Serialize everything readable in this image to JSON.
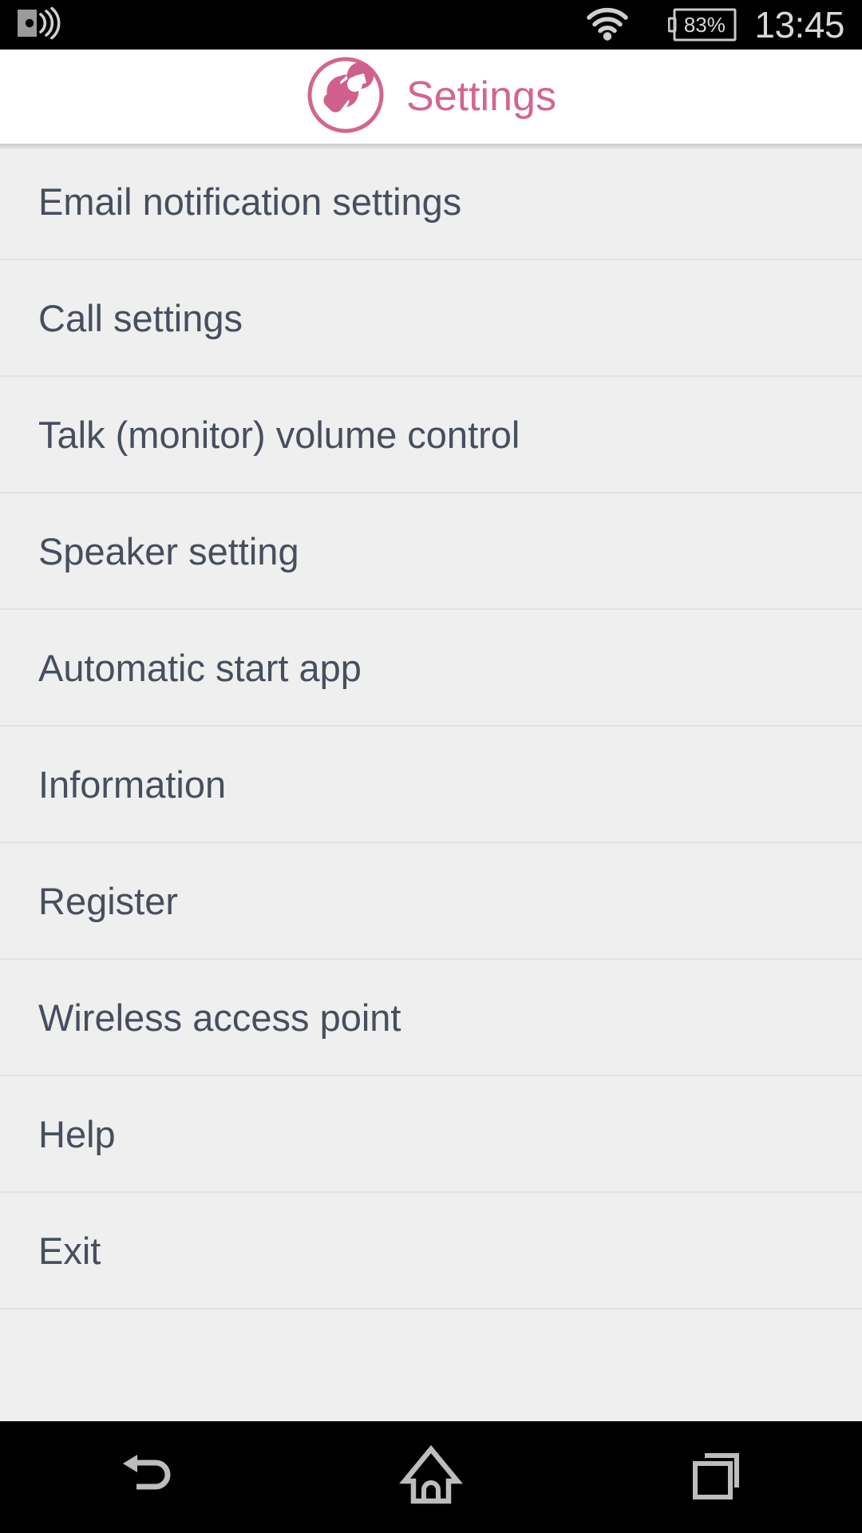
{
  "status_bar": {
    "sound_icon": "vibrate-sound-icon",
    "wifi_icon": "wifi-icon",
    "battery_icon": "battery-icon",
    "battery_level": "83%",
    "clock": "13:45"
  },
  "header": {
    "icon": "wrench-circle-icon",
    "title": "Settings",
    "accent_color": "#d4658f"
  },
  "list": {
    "items": [
      {
        "label": "Email notification settings"
      },
      {
        "label": "Call settings"
      },
      {
        "label": "Talk (monitor) volume control"
      },
      {
        "label": "Speaker setting"
      },
      {
        "label": "Automatic start app"
      },
      {
        "label": "Information"
      },
      {
        "label": "Register"
      },
      {
        "label": "Wireless access point"
      },
      {
        "label": "Help"
      },
      {
        "label": "Exit"
      }
    ]
  },
  "nav_bar": {
    "back": "back-icon",
    "home": "home-icon",
    "recents": "recents-icon"
  },
  "colors": {
    "accent": "#d4658f",
    "list_bg": "#efefef",
    "list_text": "#474f5e",
    "divider": "#e2e2e2",
    "status_bg": "#000000",
    "status_fg": "#d8d8d8",
    "header_bg": "#ffffff"
  }
}
